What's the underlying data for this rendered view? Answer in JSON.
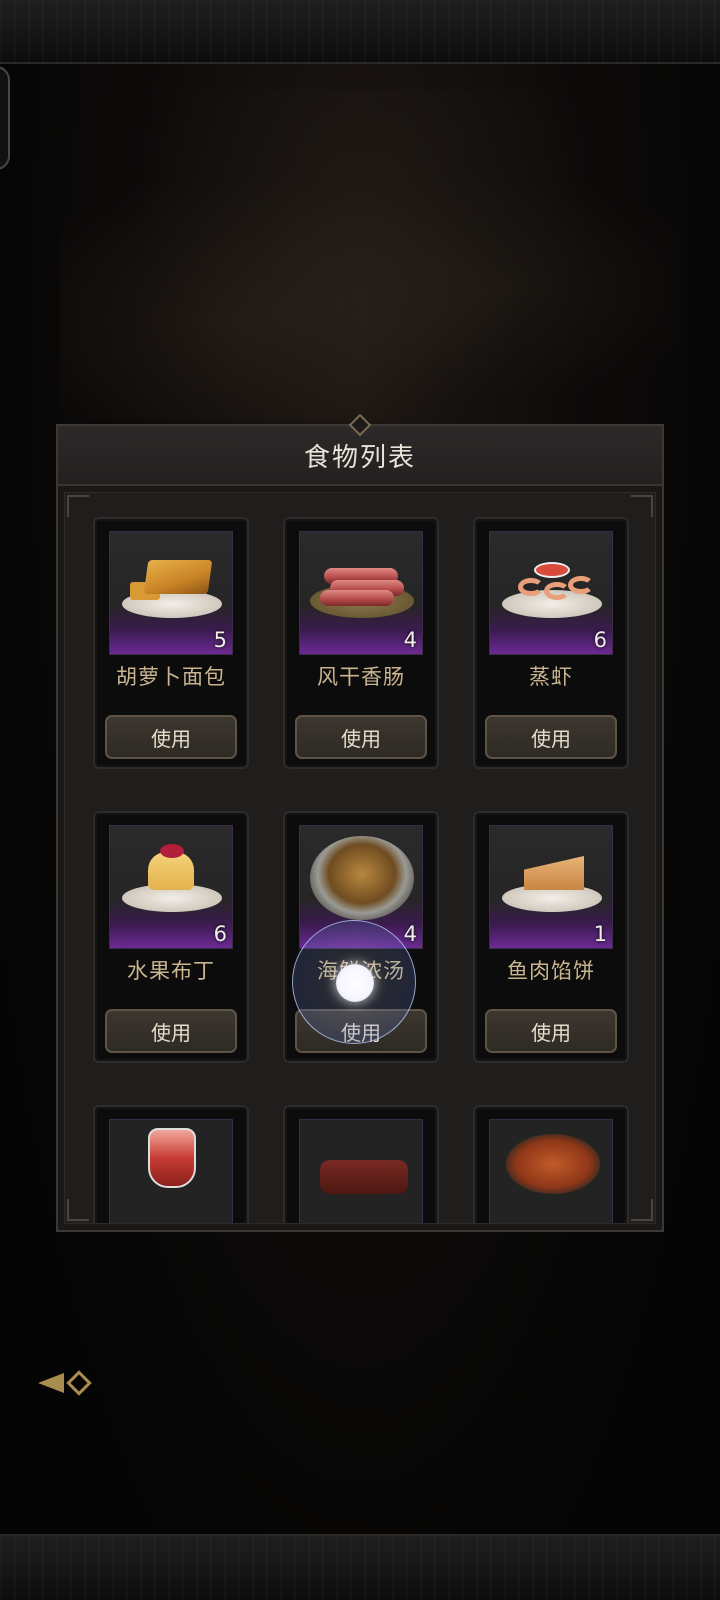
{
  "panel": {
    "title": "食物列表"
  },
  "use_label": "使用",
  "items": [
    {
      "name": "胡萝卜面包",
      "qty": "5",
      "icon": "carrot-bread-icon"
    },
    {
      "name": "风干香肠",
      "qty": "4",
      "icon": "dried-sausage-icon"
    },
    {
      "name": "蒸虾",
      "qty": "6",
      "icon": "steamed-shrimp-icon"
    },
    {
      "name": "水果布丁",
      "qty": "6",
      "icon": "fruit-pudding-icon"
    },
    {
      "name": "海鲜浓汤",
      "qty": "4",
      "icon": "seafood-soup-icon"
    },
    {
      "name": "鱼肉馅饼",
      "qty": "1",
      "icon": "fish-pie-icon"
    }
  ],
  "partial_items": [
    {
      "icon": "red-drink-icon"
    },
    {
      "icon": "grilled-meat-icon"
    },
    {
      "icon": "stew-bowl-icon"
    }
  ],
  "colors": {
    "rarity_purple": "#6b2a94",
    "name_gold": "#c9b58f",
    "accent_gold": "#a98c4f"
  }
}
